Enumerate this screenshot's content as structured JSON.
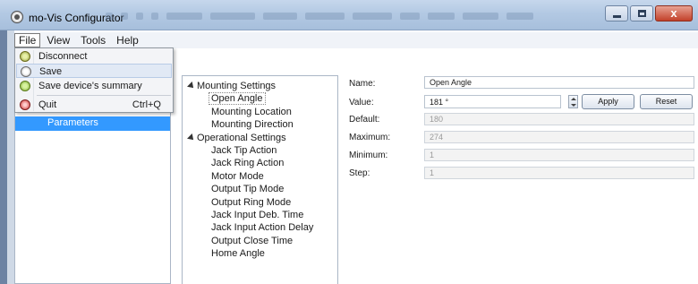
{
  "window": {
    "title": "mo-Vis Configurator",
    "close_label": "x"
  },
  "menubar": {
    "items": [
      {
        "label": "File"
      },
      {
        "label": "View"
      },
      {
        "label": "Tools"
      },
      {
        "label": "Help"
      }
    ]
  },
  "file_menu": {
    "items": [
      {
        "label": "Disconnect",
        "icon": "disconnect-icon",
        "shortcut": ""
      },
      {
        "label": "Save",
        "icon": "save-icon",
        "shortcut": ""
      },
      {
        "label": "Save device's summary",
        "icon": "summary-icon",
        "shortcut": ""
      },
      {
        "label": "Quit",
        "icon": "quit-icon",
        "shortcut": "Ctrl+Q"
      }
    ]
  },
  "left_tree": {
    "selected_label": "Parameters"
  },
  "settings_tree": {
    "groups": [
      {
        "label": "Mounting Settings",
        "children": [
          "Open Angle",
          "Mounting Location",
          "Mounting Direction"
        ]
      },
      {
        "label": "Operational Settings",
        "children": [
          "Jack Tip Action",
          "Jack Ring Action",
          "Motor Mode",
          "Output Tip Mode",
          "Output Ring Mode",
          "Jack Input Deb. Time",
          "Jack Input Action Delay",
          "Output Close Time",
          "Home Angle"
        ]
      }
    ],
    "selected": "Open Angle"
  },
  "details": {
    "name_label": "Name:",
    "name_value": "Open Angle",
    "value_label": "Value:",
    "value_value": "181 °",
    "apply_label": "Apply",
    "reset_label": "Reset",
    "default_label": "Default:",
    "default_value": "180",
    "maximum_label": "Maximum:",
    "maximum_value": "274",
    "minimum_label": "Minimum:",
    "minimum_value": "1",
    "step_label": "Step:",
    "step_value": "1"
  },
  "colors": {
    "selection": "#3399ff",
    "titlebar": "#b3c9e3",
    "close_button": "#c2412a"
  }
}
